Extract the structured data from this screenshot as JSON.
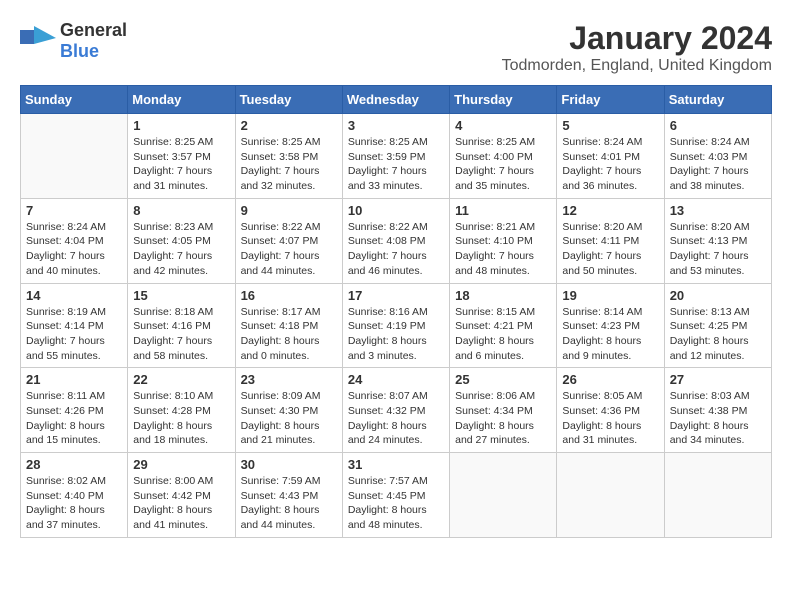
{
  "header": {
    "logo_general": "General",
    "logo_blue": "Blue",
    "title": "January 2024",
    "location": "Todmorden, England, United Kingdom"
  },
  "weekdays": [
    "Sunday",
    "Monday",
    "Tuesday",
    "Wednesday",
    "Thursday",
    "Friday",
    "Saturday"
  ],
  "weeks": [
    [
      {
        "day": "",
        "empty": true
      },
      {
        "day": "1",
        "sunrise": "Sunrise: 8:25 AM",
        "sunset": "Sunset: 3:57 PM",
        "daylight": "Daylight: 7 hours and 31 minutes."
      },
      {
        "day": "2",
        "sunrise": "Sunrise: 8:25 AM",
        "sunset": "Sunset: 3:58 PM",
        "daylight": "Daylight: 7 hours and 32 minutes."
      },
      {
        "day": "3",
        "sunrise": "Sunrise: 8:25 AM",
        "sunset": "Sunset: 3:59 PM",
        "daylight": "Daylight: 7 hours and 33 minutes."
      },
      {
        "day": "4",
        "sunrise": "Sunrise: 8:25 AM",
        "sunset": "Sunset: 4:00 PM",
        "daylight": "Daylight: 7 hours and 35 minutes."
      },
      {
        "day": "5",
        "sunrise": "Sunrise: 8:24 AM",
        "sunset": "Sunset: 4:01 PM",
        "daylight": "Daylight: 7 hours and 36 minutes."
      },
      {
        "day": "6",
        "sunrise": "Sunrise: 8:24 AM",
        "sunset": "Sunset: 4:03 PM",
        "daylight": "Daylight: 7 hours and 38 minutes."
      }
    ],
    [
      {
        "day": "7",
        "sunrise": "Sunrise: 8:24 AM",
        "sunset": "Sunset: 4:04 PM",
        "daylight": "Daylight: 7 hours and 40 minutes."
      },
      {
        "day": "8",
        "sunrise": "Sunrise: 8:23 AM",
        "sunset": "Sunset: 4:05 PM",
        "daylight": "Daylight: 7 hours and 42 minutes."
      },
      {
        "day": "9",
        "sunrise": "Sunrise: 8:22 AM",
        "sunset": "Sunset: 4:07 PM",
        "daylight": "Daylight: 7 hours and 44 minutes."
      },
      {
        "day": "10",
        "sunrise": "Sunrise: 8:22 AM",
        "sunset": "Sunset: 4:08 PM",
        "daylight": "Daylight: 7 hours and 46 minutes."
      },
      {
        "day": "11",
        "sunrise": "Sunrise: 8:21 AM",
        "sunset": "Sunset: 4:10 PM",
        "daylight": "Daylight: 7 hours and 48 minutes."
      },
      {
        "day": "12",
        "sunrise": "Sunrise: 8:20 AM",
        "sunset": "Sunset: 4:11 PM",
        "daylight": "Daylight: 7 hours and 50 minutes."
      },
      {
        "day": "13",
        "sunrise": "Sunrise: 8:20 AM",
        "sunset": "Sunset: 4:13 PM",
        "daylight": "Daylight: 7 hours and 53 minutes."
      }
    ],
    [
      {
        "day": "14",
        "sunrise": "Sunrise: 8:19 AM",
        "sunset": "Sunset: 4:14 PM",
        "daylight": "Daylight: 7 hours and 55 minutes."
      },
      {
        "day": "15",
        "sunrise": "Sunrise: 8:18 AM",
        "sunset": "Sunset: 4:16 PM",
        "daylight": "Daylight: 7 hours and 58 minutes."
      },
      {
        "day": "16",
        "sunrise": "Sunrise: 8:17 AM",
        "sunset": "Sunset: 4:18 PM",
        "daylight": "Daylight: 8 hours and 0 minutes."
      },
      {
        "day": "17",
        "sunrise": "Sunrise: 8:16 AM",
        "sunset": "Sunset: 4:19 PM",
        "daylight": "Daylight: 8 hours and 3 minutes."
      },
      {
        "day": "18",
        "sunrise": "Sunrise: 8:15 AM",
        "sunset": "Sunset: 4:21 PM",
        "daylight": "Daylight: 8 hours and 6 minutes."
      },
      {
        "day": "19",
        "sunrise": "Sunrise: 8:14 AM",
        "sunset": "Sunset: 4:23 PM",
        "daylight": "Daylight: 8 hours and 9 minutes."
      },
      {
        "day": "20",
        "sunrise": "Sunrise: 8:13 AM",
        "sunset": "Sunset: 4:25 PM",
        "daylight": "Daylight: 8 hours and 12 minutes."
      }
    ],
    [
      {
        "day": "21",
        "sunrise": "Sunrise: 8:11 AM",
        "sunset": "Sunset: 4:26 PM",
        "daylight": "Daylight: 8 hours and 15 minutes."
      },
      {
        "day": "22",
        "sunrise": "Sunrise: 8:10 AM",
        "sunset": "Sunset: 4:28 PM",
        "daylight": "Daylight: 8 hours and 18 minutes."
      },
      {
        "day": "23",
        "sunrise": "Sunrise: 8:09 AM",
        "sunset": "Sunset: 4:30 PM",
        "daylight": "Daylight: 8 hours and 21 minutes."
      },
      {
        "day": "24",
        "sunrise": "Sunrise: 8:07 AM",
        "sunset": "Sunset: 4:32 PM",
        "daylight": "Daylight: 8 hours and 24 minutes."
      },
      {
        "day": "25",
        "sunrise": "Sunrise: 8:06 AM",
        "sunset": "Sunset: 4:34 PM",
        "daylight": "Daylight: 8 hours and 27 minutes."
      },
      {
        "day": "26",
        "sunrise": "Sunrise: 8:05 AM",
        "sunset": "Sunset: 4:36 PM",
        "daylight": "Daylight: 8 hours and 31 minutes."
      },
      {
        "day": "27",
        "sunrise": "Sunrise: 8:03 AM",
        "sunset": "Sunset: 4:38 PM",
        "daylight": "Daylight: 8 hours and 34 minutes."
      }
    ],
    [
      {
        "day": "28",
        "sunrise": "Sunrise: 8:02 AM",
        "sunset": "Sunset: 4:40 PM",
        "daylight": "Daylight: 8 hours and 37 minutes."
      },
      {
        "day": "29",
        "sunrise": "Sunrise: 8:00 AM",
        "sunset": "Sunset: 4:42 PM",
        "daylight": "Daylight: 8 hours and 41 minutes."
      },
      {
        "day": "30",
        "sunrise": "Sunrise: 7:59 AM",
        "sunset": "Sunset: 4:43 PM",
        "daylight": "Daylight: 8 hours and 44 minutes."
      },
      {
        "day": "31",
        "sunrise": "Sunrise: 7:57 AM",
        "sunset": "Sunset: 4:45 PM",
        "daylight": "Daylight: 8 hours and 48 minutes."
      },
      {
        "day": "",
        "empty": true
      },
      {
        "day": "",
        "empty": true
      },
      {
        "day": "",
        "empty": true
      }
    ]
  ]
}
